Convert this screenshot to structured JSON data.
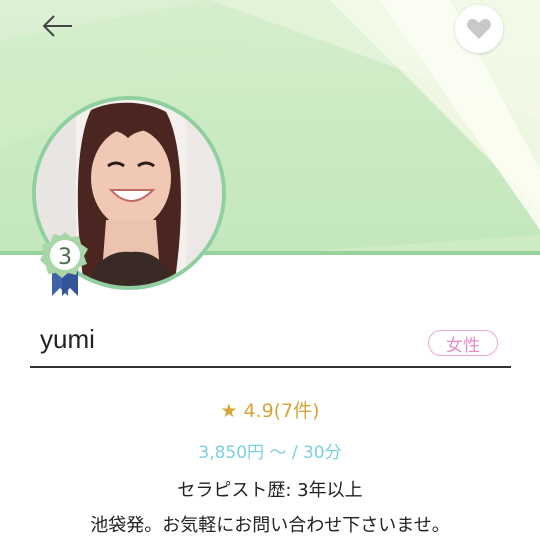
{
  "header": {
    "back_icon": "arrow-left-icon",
    "favorite_icon": "heart-icon"
  },
  "profile": {
    "name": "yumi",
    "gender": "女性",
    "rank": "3",
    "rating": "★ 4.9(7件)",
    "price": "3,850円 〜 / 30分",
    "experience": "セラピスト歴: 3年以上",
    "message": "池袋発。お気軽にお問い合わせ下さいませ。"
  },
  "colors": {
    "banner_green": "#c3e7bd",
    "accent_line": "#95d39a",
    "rating_gold": "#d4a537",
    "price_blue": "#7bcfe0",
    "gender_pink": "#e28fca"
  }
}
